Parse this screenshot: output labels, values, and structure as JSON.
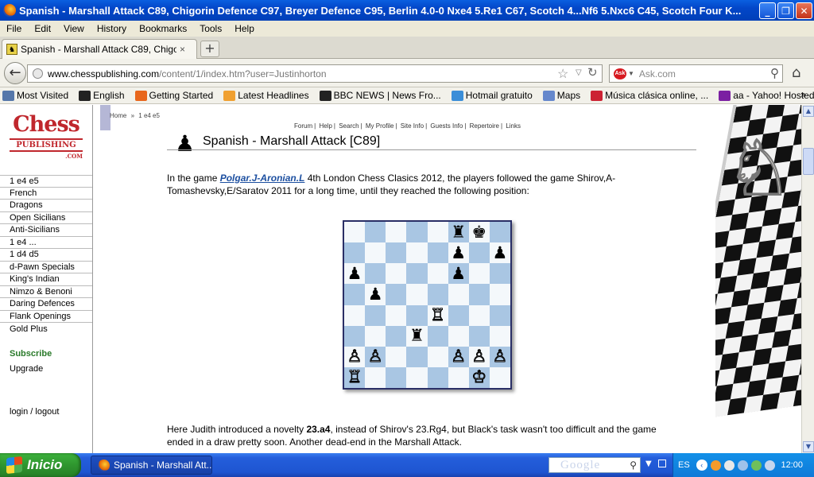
{
  "window": {
    "title": "Spanish - Marshall Attack C89, Chigorin Defence C97, Breyer Defence C95, Berlin 4.0-0 Nxe4 5.Re1 C67, Scotch 4...Nf6 5.Nxc6 C45, Scotch Four K...",
    "min": "_",
    "max": "❐",
    "close": "✕"
  },
  "menu": [
    "File",
    "Edit",
    "View",
    "History",
    "Bookmarks",
    "Tools",
    "Help"
  ],
  "tab": {
    "label": "Spanish - Marshall Attack C89, Chigorin Defe...",
    "close": "×",
    "new": "+"
  },
  "nav": {
    "url_domain": "www.chesspublishing.com",
    "url_path": "/content/1/index.htm?user=Justinhorton",
    "search_placeholder": "Ask.com"
  },
  "bookmarks": [
    {
      "label": "Most Visited",
      "color": "#5577aa"
    },
    {
      "label": "English",
      "color": "#222222"
    },
    {
      "label": "Getting Started",
      "color": "#e8661c"
    },
    {
      "label": "Latest Headlines",
      "color": "#f0a030"
    },
    {
      "label": "BBC NEWS | News Fro...",
      "color": "#222222"
    },
    {
      "label": "Hotmail gratuito",
      "color": "#3b8ed8"
    },
    {
      "label": "Maps",
      "color": "#6688cc"
    },
    {
      "label": "Música clásica online, ...",
      "color": "#cc2233"
    },
    {
      "label": "aa - Yahoo! Hosted S...",
      "color": "#7b1fa2"
    }
  ],
  "bookmarks_more": "»",
  "site": {
    "logo_line1": "Chess",
    "logo_line2": "PUBLISHING",
    "logo_line3": ".COM",
    "left_nav": [
      "1 e4 e5",
      "French",
      "Dragons",
      "Open Sicilians",
      "Anti-Sicilians",
      "1 e4 ...",
      "1 d4 d5",
      "d-Pawn Specials",
      "King's Indian",
      "Nimzo & Benoni",
      "Daring Defences",
      "Flank Openings"
    ],
    "gold_plus": "Gold Plus",
    "subscribe": "Subscribe",
    "upgrade": "Upgrade",
    "login": "login",
    "login_sep": " / ",
    "logout": "logout",
    "breadcrumb": [
      "Home",
      "»",
      "1 e4 e5"
    ],
    "top_links": [
      "Forum",
      "Help",
      "Search",
      "My Profile",
      "Site Info",
      "Guests Info",
      "Repertoire",
      "Links"
    ],
    "heading": "Spanish - Marshall Attack [C89]",
    "para1": {
      "before": "In the game ",
      "game_link": "Polgar.J-Aronian.L",
      "after": " 4th London Chess Clasics 2012, the players followed the game Shirov,A-Tomashevsky,E/Saratov 2011 for a long time, until they reached the following position:"
    },
    "para2": {
      "before": "Here Judith introduced a novelty ",
      "move": "23.a4",
      "after": ", instead of Shirov's 23.Rg4, but Black's task wasn't too difficult and the game ended in a draw pretty soon. Another dead-end in the Marshall Attack."
    }
  },
  "board": {
    "rows": [
      [
        "",
        "",
        "",
        "",
        "",
        "br",
        "bk",
        ""
      ],
      [
        "",
        "",
        "",
        "",
        "",
        "bp",
        "",
        "bp"
      ],
      [
        "bp",
        "",
        "",
        "",
        "",
        "bp",
        "",
        ""
      ],
      [
        "",
        "bp",
        "",
        "",
        "",
        "",
        "",
        ""
      ],
      [
        "",
        "",
        "",
        "",
        "wr",
        "",
        "",
        ""
      ],
      [
        "",
        "",
        "",
        "br",
        "",
        "",
        "",
        ""
      ],
      [
        "wp",
        "wp",
        "",
        "",
        "",
        "wp",
        "wp",
        "wp"
      ],
      [
        "wr",
        "",
        "",
        "",
        "",
        "",
        "wk",
        ""
      ]
    ]
  },
  "taskbar": {
    "start": "Inicio",
    "task": "Spanish - Marshall Att...",
    "google": "Google",
    "lang": "ES",
    "clock": "12:00"
  }
}
